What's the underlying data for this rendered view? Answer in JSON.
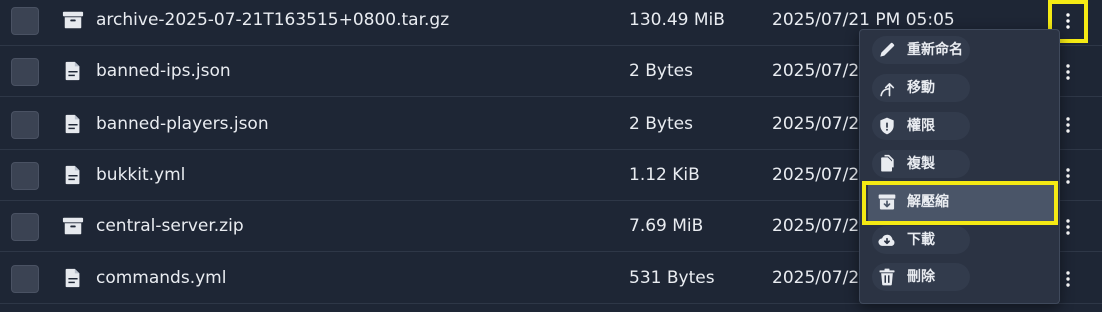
{
  "files": [
    {
      "name": "archive-2025-07-21T163515+0800.tar.gz",
      "size": "130.49 MiB",
      "date": "2025/07/21 PM 05:05",
      "icon": "archive-icon"
    },
    {
      "name": "banned-ips.json",
      "size": "2 Bytes",
      "date": "2025/07/2",
      "icon": "file-icon"
    },
    {
      "name": "banned-players.json",
      "size": "2 Bytes",
      "date": "2025/07/2",
      "icon": "file-icon"
    },
    {
      "name": "bukkit.yml",
      "size": "1.12 KiB",
      "date": "2025/07/2",
      "icon": "file-icon"
    },
    {
      "name": "central-server.zip",
      "size": "7.69 MiB",
      "date": "2025/07/2",
      "icon": "archive-icon"
    },
    {
      "name": "commands.yml",
      "size": "531 Bytes",
      "date": "2025/07/2",
      "icon": "file-icon"
    }
  ],
  "context_menu": {
    "items": [
      {
        "label": "重新命名",
        "icon": "pencil-icon"
      },
      {
        "label": "移動",
        "icon": "move-arrow-icon"
      },
      {
        "label": "權限",
        "icon": "shield-icon"
      },
      {
        "label": "複製",
        "icon": "copy-icon"
      },
      {
        "label": "解壓縮",
        "icon": "decompress-icon",
        "active": true
      },
      {
        "label": "下載",
        "icon": "cloud-download-icon"
      },
      {
        "label": "刪除",
        "icon": "trash-icon"
      }
    ]
  },
  "colors": {
    "background": "#1e2635",
    "menu_background": "#2b3343",
    "highlight": "#f5ea14",
    "text": "#e9ecf1"
  }
}
